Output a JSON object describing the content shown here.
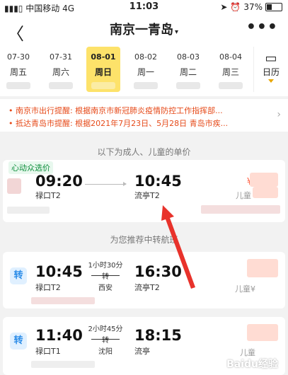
{
  "status": {
    "carrier": "中国移动",
    "network": "4G",
    "time": "11:03",
    "battery": "37%"
  },
  "nav": {
    "title": "南京一青岛",
    "title_caret": "▾",
    "back": "〈",
    "more": "•••"
  },
  "dates": [
    {
      "date": "07-30",
      "weekday": "周五",
      "selected": false
    },
    {
      "date": "07-31",
      "weekday": "周六",
      "selected": false
    },
    {
      "date": "08-01",
      "weekday": "周日",
      "selected": true
    },
    {
      "date": "08-02",
      "weekday": "周一",
      "selected": false
    },
    {
      "date": "08-03",
      "weekday": "周二",
      "selected": false
    },
    {
      "date": "08-04",
      "weekday": "周三",
      "selected": false
    }
  ],
  "calendar": {
    "label": "日历"
  },
  "notices": [
    "• 南京市出行提醒: 根据南京市新冠肺炎疫情防控工作指挥部...",
    "• 抵达青岛市提醒: 根据2021年7月23日、5月28日 青岛市疾..."
  ],
  "section_direct": "以下为成人、儿童的单价",
  "direct_flight": {
    "tag": "心动众选价",
    "dep_time": "09:20",
    "dep_airport": "禄口T2",
    "arr_time": "10:45",
    "arr_airport": "流亭T2",
    "currency": "¥",
    "child_label": "儿童"
  },
  "section_transfer": "为您推荐中转航班",
  "transfers": [
    {
      "badge": "转",
      "dep_time": "10:45",
      "dep_airport": "禄口T2",
      "duration": "1小时30分",
      "via_label": "转",
      "via_city": "西安",
      "arr_time": "16:30",
      "arr_airport": "流亭T2",
      "child_label": "儿童¥"
    },
    {
      "badge": "转",
      "dep_time": "11:40",
      "dep_airport": "禄口T1",
      "duration": "2小时45分",
      "via_label": "转",
      "via_city": "沈阳",
      "arr_time": "18:15",
      "arr_airport": "流亭",
      "child_label": "儿童"
    }
  ],
  "watermark": "Baidu经验",
  "colors": {
    "selected_date": "#fde26a",
    "notice": "#e64a19",
    "price": "#ff5a3c",
    "annotation_arrow": "#e8322b",
    "tag_green": "#0c8e3a"
  }
}
